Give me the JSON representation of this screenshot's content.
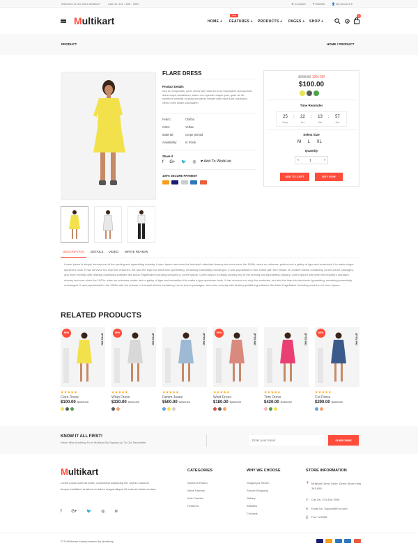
{
  "topbar": {
    "welcome": "Welcome to Our store Multikart",
    "call": "Call Us: 123 - 456 - 7890",
    "compare": "Compare",
    "wishlist": "Wishlist",
    "account": "My Account"
  },
  "header": {
    "logo_m": "M",
    "logo_rest": "ultikart",
    "nav": [
      "HOME",
      "FEATURES",
      "PRODUCTS",
      "PAGES",
      "SHOP"
    ],
    "features_badge": "new",
    "cart_count": "0"
  },
  "breadcrumb": {
    "title": "PRODUCT",
    "home": "HOME",
    "sep": "/",
    "current": "PRODUCT"
  },
  "product": {
    "name": "FLARE DRESS",
    "details_title": "Product Details",
    "description": "Sed ut perspiciatis, unde omnis iste natus error sit voluptatem accusantium doloremque laudantium, totam rem aperiam eaque ipsa, quae ab illo inventore veritatis et quasi architecto beatae vitae dicta sunt, explicabo. Nemo enim ipsam voluptatem,",
    "specs": [
      {
        "label": "Febric:",
        "value": "Chiffon"
      },
      {
        "label": "Color:",
        "value": "Yellow"
      },
      {
        "label": "Material:",
        "value": "Crepe printed"
      },
      {
        "label": "Availability:",
        "value": "In Stock"
      }
    ],
    "share_label": "Share it",
    "wishlist_label": "Add To WishList",
    "secure_label": "100% SECURE PAYMENT",
    "old_price": "$200.00",
    "discount": "10% Off",
    "price": "$100.00",
    "colors": [
      "#e6e651",
      "#5d5d5d",
      "#4fa24c"
    ],
    "timer_title": "Time Reminder",
    "timer": [
      {
        "num": "25",
        "unit": "Days"
      },
      {
        "num": "22",
        "unit": "Hrs"
      },
      {
        "num": "13",
        "unit": "Min"
      },
      {
        "num": "57",
        "unit": "Sec"
      }
    ],
    "size_title": "Select Size",
    "sizes": [
      "M",
      "L",
      "XL"
    ],
    "qty_title": "Quantity",
    "qty": "1",
    "add_to_cart": "ADD TO CART",
    "buy_now": "BUY NOW"
  },
  "tabs": [
    "DESCRIPTION",
    "DETAILS",
    "VIDEO",
    "WRITE REVIEW"
  ],
  "tab_text": "Lorem Ipsum is simply dummy text of the printing and typesetting industry. Lorem Ipsum has been the industry's standard dummy text ever since the 1500s, when an unknown printer took a galley of type and scrambled it to make a type specimen book. It has survived not only five centuries, but also the leap into electronic typesetting, remaining essentially unchanged. It was popularised in the 1960s with the release of Letraset sheets containing Lorem Ipsum passages, and more recently with desktop publishing software like Aldus PageMaker including versions of Lorem Ipsum. Lorem Ipsum is simply dummy text of the printing and typesetting industry. Lorem Ipsum has been the industry's standard dummy text ever since the 1500s, when an unknown printer took a galley of type and scrambled it to make a type specimen book. It has survived not only five centuries, but also the leap into electronic typesetting, remaining essentially unchanged. It was popularised in the 1960s with the release of Letraset sheets containing Lorem Ipsum passages, and more recently with desktop publishing software like Aldus PageMaker including versions of Lorem Ipsum.",
  "related": {
    "title": "RELATED PRODUCTS",
    "new_label": "NEW",
    "sale_label": "ON SALE",
    "stars": "★★★★★",
    "items": [
      {
        "name": "Flare Dress",
        "price": "$100.00",
        "old": "$300.00",
        "badge": "new",
        "dots": [
          "#e6e651",
          "#5d5d5d",
          "#4fa24c"
        ],
        "dress": "#f2e14a"
      },
      {
        "name": "Wrap Dress",
        "price": "$330.00",
        "old": "$344.00",
        "badge": "new",
        "dots": [
          "#5d5d5d",
          "#f4a36c"
        ],
        "dress": "#d8d8d8"
      },
      {
        "name": "Denim Jeans",
        "price": "$500.00",
        "old": "$350.00",
        "badge": "",
        "dots": [
          "#5aa6e8",
          "#f5e04f",
          "#cfcfcf"
        ],
        "dress": "#9db9d4"
      },
      {
        "name": "Weid Dress",
        "price": "$180.00",
        "old": "$250.00",
        "badge": "new",
        "dots": [
          "#e24b3b",
          "#5d5d5d",
          "#f4a36c"
        ],
        "dress": "#d98a7e"
      },
      {
        "name": "Trim Dress",
        "price": "$420.00",
        "old": "$400.00",
        "badge": "",
        "dots": [
          "#f5b5c5",
          "#4fa24c",
          "#f5e04f"
        ],
        "dress": "#e93f74"
      },
      {
        "name": "Cut Dress",
        "price": "$290.00",
        "old": "$300.00",
        "badge": "new",
        "dots": [
          "#5aa6e8",
          "#f4a36c"
        ],
        "dress": "#3b5a8c"
      }
    ]
  },
  "newsletter": {
    "title": "KNOW IT ALL FIRST!",
    "subtitle": "Never Miss Anything From Multikart By Signing Up To Our Newsletter.",
    "placeholder": "Enter your email",
    "button": "SUBSCRIBE"
  },
  "footer": {
    "about": "Lorem ipsum dolor sit amet, consectetur adipiscing elit, sed do eiusmod tempor incididunt ut labore et dolore magna aliqua. Ut enim ad minim veniam,",
    "categories_title": "CATEGORIES",
    "categories": [
      "Womens Fasion",
      "Mens Fashion",
      "Kids Fashion",
      "Featured"
    ],
    "why_title": "WHY WE CHOOSE",
    "why": [
      "Shipping & Return",
      "Secure Shopping",
      "Gallary",
      "Affiliates",
      "Contacts"
    ],
    "store_title": "STORE INFORMATION",
    "address": "Multikart Demo Store, Demo Store India 345-659",
    "phone": "Call Us: 123-456-7898",
    "email": "Email Us: Support@Fiot.com",
    "fax": "Fax: 123456",
    "copyright": "© 2018 theme forest powered by pixelstrap"
  }
}
